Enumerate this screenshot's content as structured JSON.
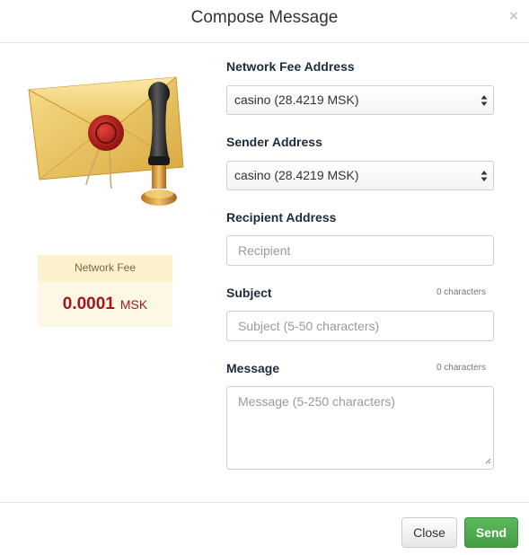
{
  "dialog": {
    "title": "Compose Message",
    "close_symbol": "×"
  },
  "fee": {
    "label": "Network Fee",
    "amount": "0.0001",
    "unit": "MSK"
  },
  "form": {
    "network_fee_address": {
      "label": "Network Fee Address",
      "selected": "casino (28.4219 MSK)"
    },
    "sender_address": {
      "label": "Sender Address",
      "selected": "casino (28.4219 MSK)"
    },
    "recipient": {
      "label": "Recipient Address",
      "placeholder": "Recipient",
      "value": ""
    },
    "subject": {
      "label": "Subject",
      "counter": "0 characters",
      "placeholder": "Subject (5-50 characters)",
      "value": ""
    },
    "message": {
      "label": "Message",
      "counter": "0 characters",
      "placeholder": "Message (5-250 characters)",
      "value": ""
    }
  },
  "footer": {
    "close_label": "Close",
    "send_label": "Send"
  },
  "colors": {
    "fee_value": "#a5151b",
    "send_button": "#5cb85c",
    "fee_box_background": "#fdf8e6"
  },
  "icons": {
    "illustration": "sealed-envelope-with-wax-stamp",
    "select_arrows": "up-down-arrows-icon",
    "close": "close-icon"
  }
}
